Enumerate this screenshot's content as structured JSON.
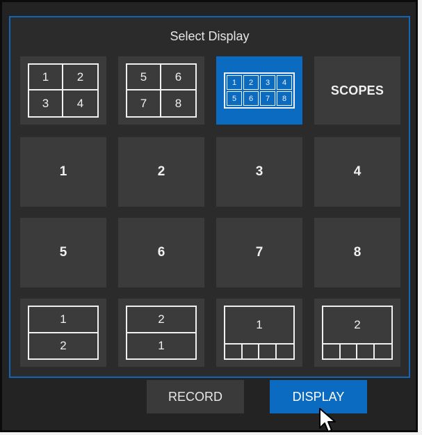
{
  "title": "Select Display",
  "presets": {
    "quad_a": [
      "1",
      "2",
      "3",
      "4"
    ],
    "quad_b": [
      "5",
      "6",
      "7",
      "8"
    ],
    "octo": [
      "1",
      "2",
      "3",
      "4",
      "5",
      "6",
      "7",
      "8"
    ],
    "scopes_label": "SCOPES"
  },
  "outputs": [
    "1",
    "2",
    "3",
    "4",
    "5",
    "6",
    "7",
    "8"
  ],
  "layouts": {
    "split_a": [
      "1",
      "2"
    ],
    "split_b": [
      "2",
      "1"
    ],
    "main_a": "1",
    "main_b": "2"
  },
  "tabs": {
    "record": "RECORD",
    "display": "DISPLAY"
  },
  "colors": {
    "accent": "#0b6bc0",
    "tile": "#3b3b3b",
    "panel_border": "#1565b6"
  }
}
